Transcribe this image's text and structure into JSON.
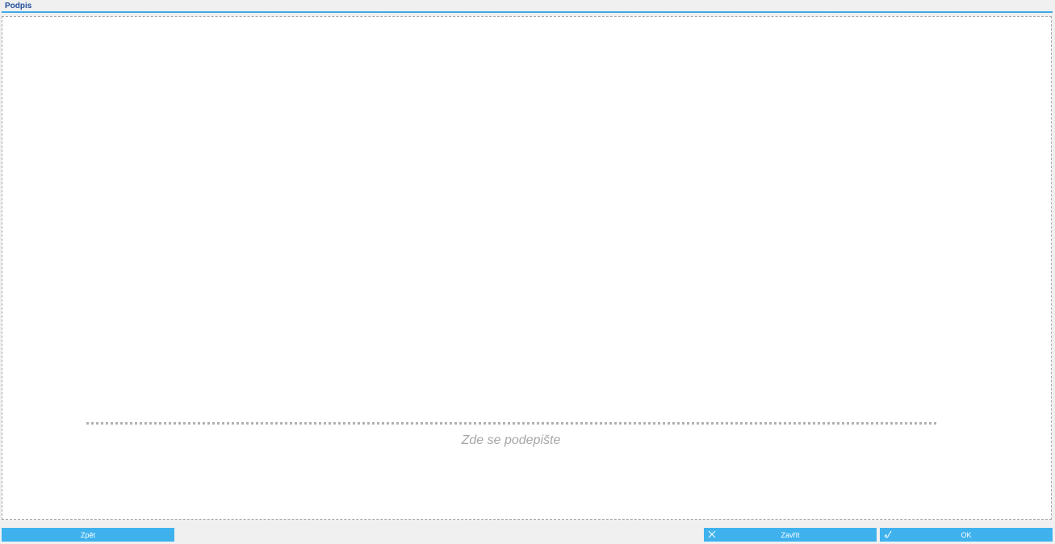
{
  "header": {
    "title": "Podpis"
  },
  "signature": {
    "hint": "Zde se podepište"
  },
  "buttons": {
    "back_label": "Zpět",
    "close_label": "Zavřít",
    "ok_label": "OK"
  },
  "icons": {
    "close": "close-icon",
    "ok": "signature-pen-icon"
  },
  "colors": {
    "accent": "#3fb2ee",
    "title": "#1f4e99",
    "hint": "#a6a6a6"
  }
}
